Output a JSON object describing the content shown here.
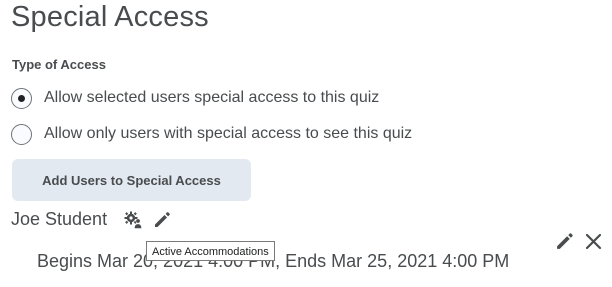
{
  "page": {
    "title": "Special Access",
    "type_of_access_label": "Type of Access"
  },
  "access_options": [
    {
      "label": "Allow selected users special access to this quiz",
      "selected": true
    },
    {
      "label": "Allow only users with special access to see this quiz",
      "selected": false
    }
  ],
  "add_users_button": {
    "label": "Add Users to Special Access"
  },
  "special_access_users": [
    {
      "name": "Joe Student",
      "dates": "Begins Mar 20, 2021 4:00 PM, Ends Mar 25, 2021 4:00 PM",
      "accommodation_icon": "accommodations-icon",
      "edit_icon": "pencil-icon"
    }
  ],
  "tooltip": {
    "text": "Active Accommodations"
  },
  "row_actions": {
    "edit_icon": "pencil-icon",
    "remove_icon": "close-icon"
  },
  "colors": {
    "text": "#494c4e",
    "button_bg": "#e3e9f1",
    "icon": "#494c4e"
  }
}
